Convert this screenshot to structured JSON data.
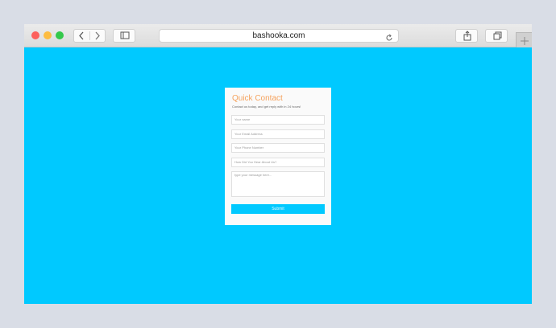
{
  "browser": {
    "url": "bashooka.com",
    "icons": {
      "back": "chevron-left-icon",
      "forward": "chevron-right-icon",
      "sidebar": "sidebar-icon",
      "reload": "reload-icon",
      "share": "share-icon",
      "tabs": "tabs-overview-icon",
      "new_tab": "plus-icon"
    }
  },
  "form": {
    "title": "Quick Contact",
    "subtitle": "Contact us today, and get reply with in 24 hours!",
    "name_placeholder": "Your name",
    "email_placeholder": "Your Email Address",
    "phone_placeholder": "Your Phone Number",
    "hear_placeholder": "How Did You Hear About Us?",
    "message_placeholder": "type your message here...",
    "submit_label": "Submit"
  },
  "colors": {
    "page_background": "#00c9ff",
    "title": "#f5a25d",
    "submit_button": "#00c9ff"
  }
}
